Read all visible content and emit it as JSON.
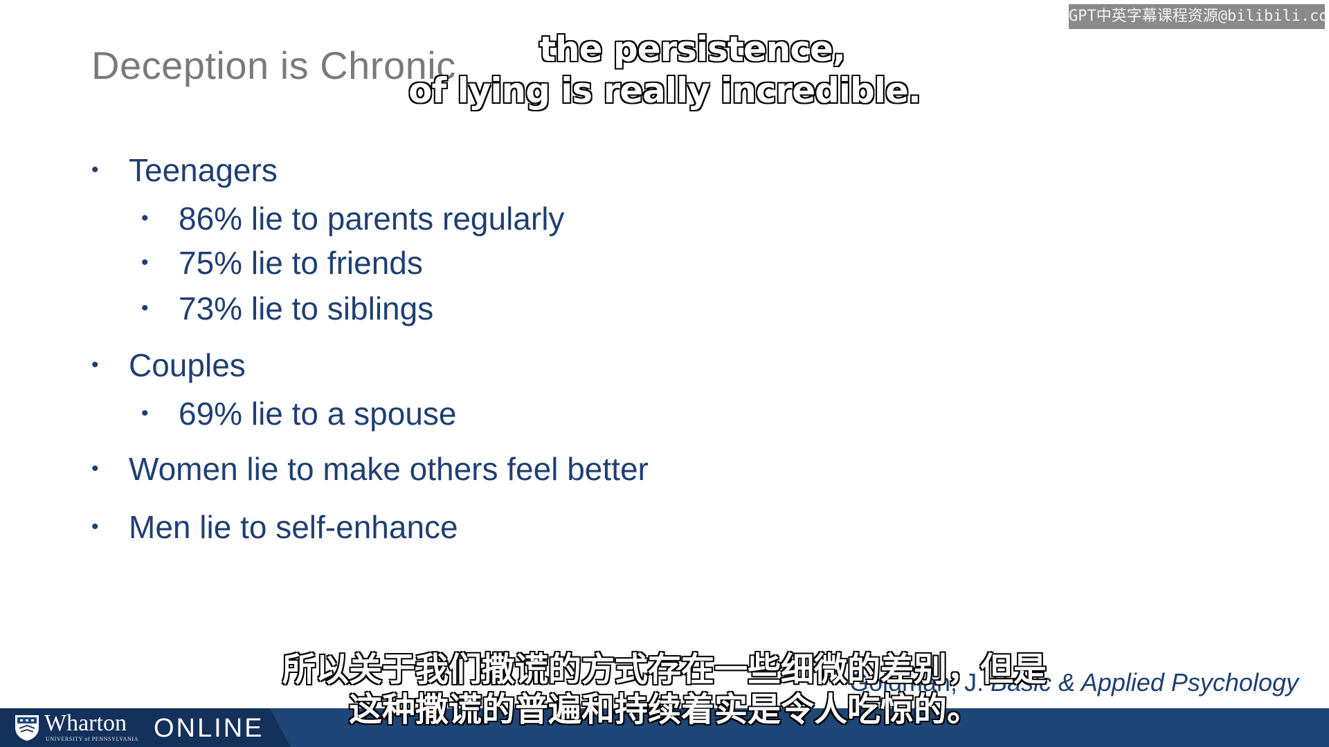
{
  "watermark": "GPT中英字幕课程资源@bilibili.com",
  "slide": {
    "title": "Deception is Chronic",
    "bullet_char": "•",
    "groups": [
      {
        "label": "Teenagers",
        "items": [
          "86% lie to parents regularly",
          "75% lie to friends",
          "73% lie to siblings"
        ]
      },
      {
        "label": "Couples",
        "items": [
          "69% lie to a spouse"
        ]
      },
      {
        "label": "Women lie to make others feel better",
        "items": []
      },
      {
        "label": "Men lie to self-enhance",
        "items": []
      }
    ],
    "citation": {
      "author": "Goldman, J.",
      "work": "Basic & Applied Psychology"
    }
  },
  "subtitles": {
    "en": [
      "the persistence,",
      "of lying is really incredible."
    ],
    "zh": [
      "所以关于我们撒谎的方式存在一些细微的差别，但是",
      "这种撒谎的普遍和持续着实是令人吃惊的。"
    ]
  },
  "footer": {
    "brand": "Wharton",
    "brand_sub": "UNIVERSITY of PENNSYLVANIA",
    "product": "ONLINE"
  },
  "colors": {
    "title_gray": "#7a7a7a",
    "text_navy": "#1f3f73",
    "footer_blue": "#1e4778",
    "footer_dark": "#13315a"
  },
  "icons": {
    "footer_logo": "wharton-shield-icon"
  }
}
